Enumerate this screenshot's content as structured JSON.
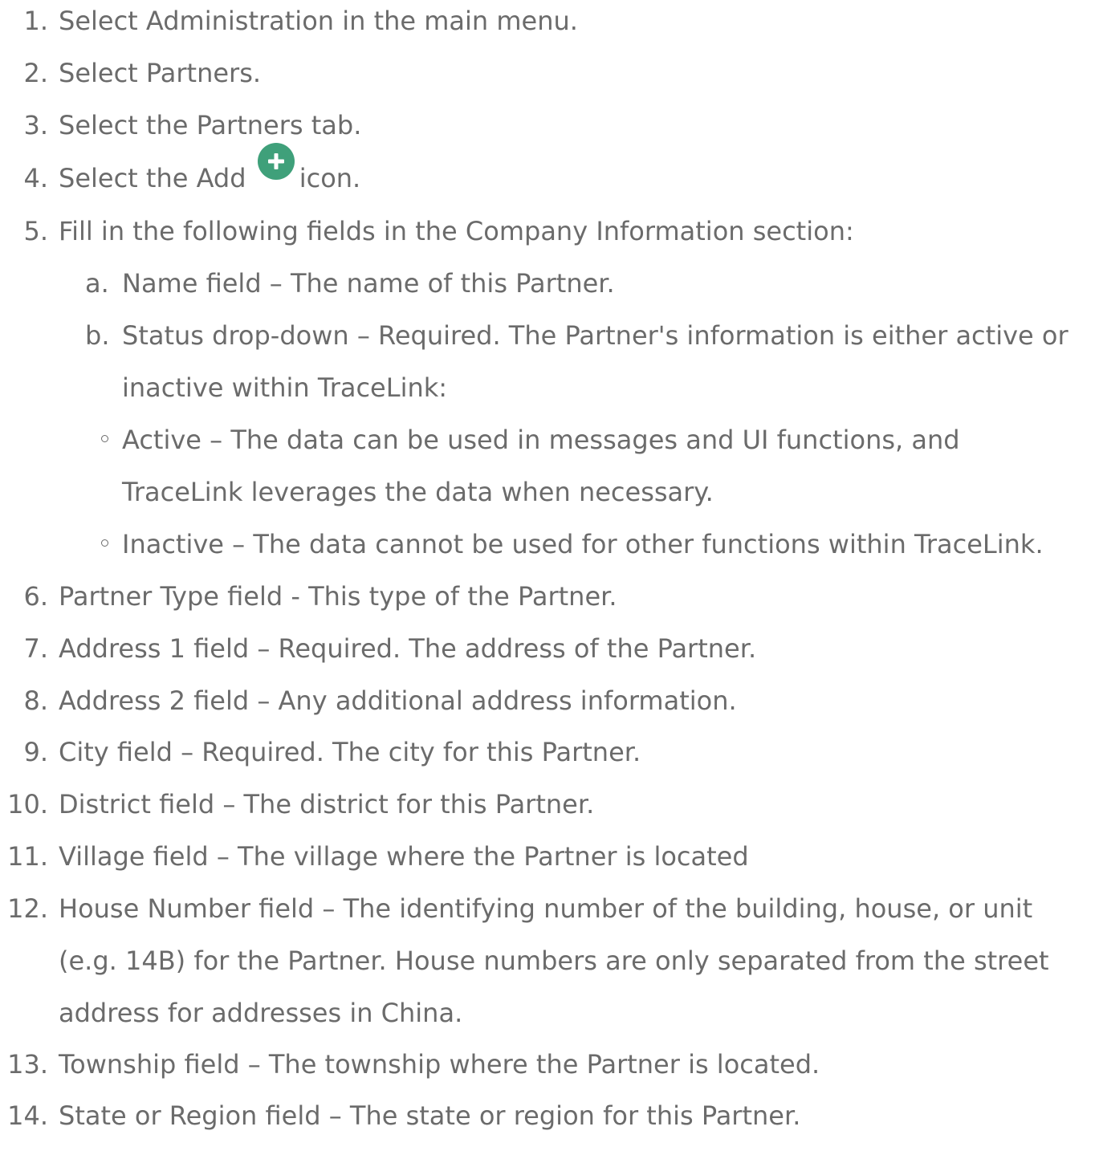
{
  "steps": [
    {
      "num": "1.",
      "text": "Select Administration in the main menu."
    },
    {
      "num": "2.",
      "text": "Select Partners."
    },
    {
      "num": "3.",
      "text": "Select the Partners tab."
    },
    {
      "num": "4.",
      "text_before": "Select the Add",
      "text_after": "icon."
    },
    {
      "num": "5.",
      "text": "Fill in the following fields in the Company Information section:"
    },
    {
      "num": "6.",
      "text": "Partner Type field - This type of the Partner."
    },
    {
      "num": "7.",
      "text": "Address 1 field – Required. The address of the Partner."
    },
    {
      "num": "8.",
      "text": "Address 2 field – Any additional address information."
    },
    {
      "num": "9.",
      "text": "City field – Required. The city for this Partner."
    },
    {
      "num": "10.",
      "text": "District field – The district for this Partner."
    },
    {
      "num": "11.",
      "text": "Village field – The village where the Partner is located"
    },
    {
      "num": "12.",
      "lines": [
        "House Number field – The identifying number of the building, house, or unit",
        "(e.g. 14B) for the Partner. House numbers are only separated from the street",
        "address for addresses in China."
      ]
    },
    {
      "num": "13.",
      "text": "Township field – The township where the Partner is located."
    },
    {
      "num": "14.",
      "text": "State or Region field – The state or region for this Partner."
    }
  ],
  "substeps": [
    {
      "letter": "a.",
      "text": "Name field – The name of this Partner."
    },
    {
      "letter": "b.",
      "lines": [
        "Status drop-down – Required. The Partner's information is either active or",
        "inactive within TraceLink:"
      ]
    }
  ],
  "status_options": [
    {
      "lines": [
        "Active – The data can be used in messages and UI functions, and",
        "TraceLink leverages the data when necessary."
      ]
    },
    {
      "text": "Inactive – The data cannot be used for other functions within TraceLink."
    }
  ],
  "icons": {
    "add_icon": "plus-circle-icon",
    "add_icon_color": "#3fa07a"
  },
  "colors": {
    "text": "#6b6b6b",
    "background": "#ffffff"
  }
}
